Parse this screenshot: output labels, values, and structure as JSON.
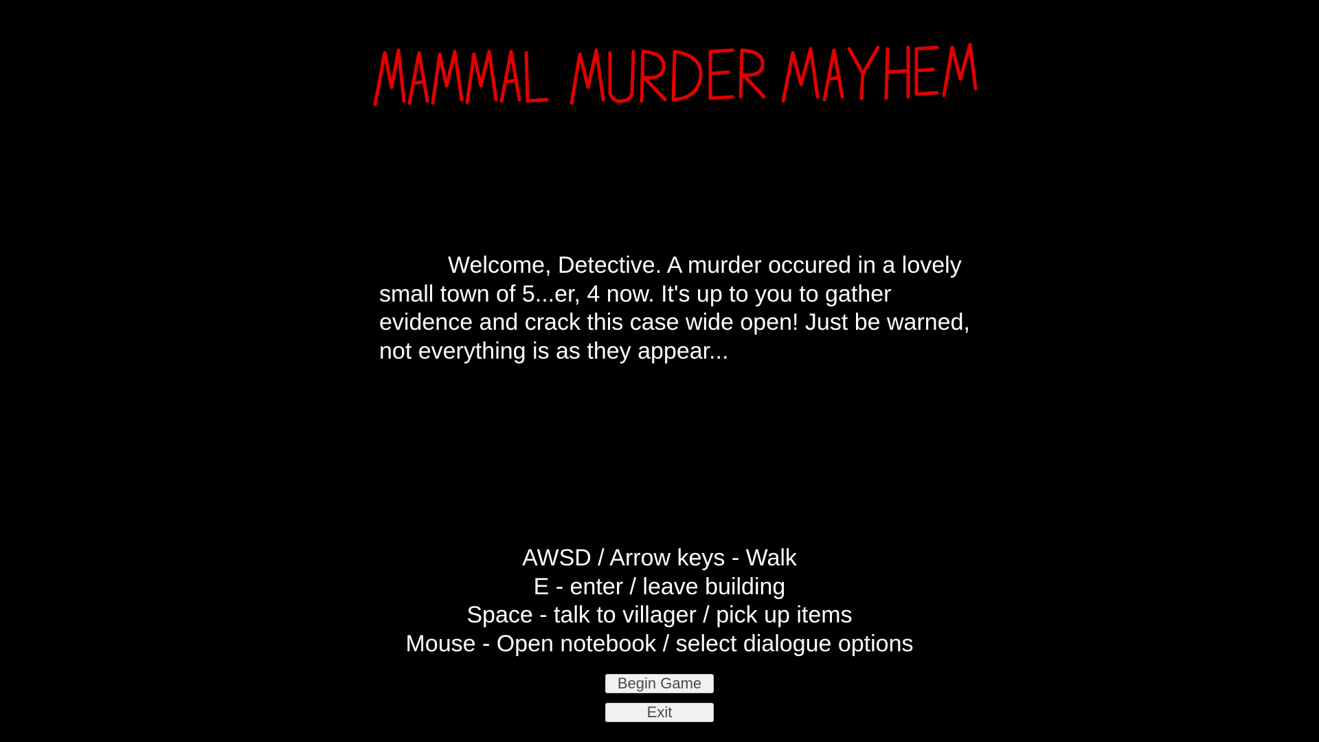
{
  "game": {
    "title": "MAMMAL MURDER MAYHEM",
    "title_color": "#e30000",
    "intro_text": "Welcome, Detective. A murder occured in a lovely small town of 5...er, 4 now. It's up to you to gather evidence and crack this case wide open! Just be warned, not everything is as they appear...",
    "controls": [
      "AWSD / Arrow keys - Walk",
      "E - enter / leave building",
      "Space - talk to villager / pick up items",
      "Mouse - Open notebook / select dialogue options"
    ]
  },
  "menu": {
    "begin_label": "Begin Game",
    "exit_label": "Exit"
  },
  "colors": {
    "background": "#000000",
    "text": "#ffffff",
    "button_bg": "#f1f1f1",
    "button_text": "#4a4a4a"
  }
}
